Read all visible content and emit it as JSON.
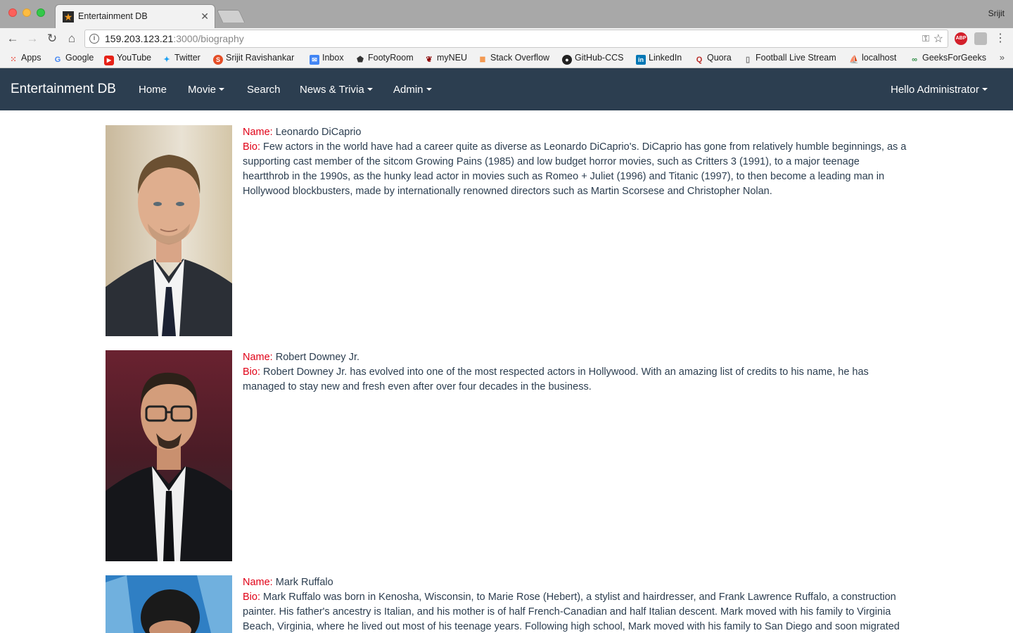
{
  "browser": {
    "tab_title": "Entertainment DB",
    "profile_name": "Srijit",
    "url_host": "159.203.123.21",
    "url_path": ":3000/biography",
    "extensions": [
      "ABP",
      ""
    ],
    "bookmarks": [
      {
        "label": "Apps",
        "icon": "apps-icon"
      },
      {
        "label": "Google",
        "icon": "google-icon"
      },
      {
        "label": "YouTube",
        "icon": "youtube-icon"
      },
      {
        "label": "Twitter",
        "icon": "twitter-icon"
      },
      {
        "label": "Srijit Ravishankar",
        "icon": "profile-icon"
      },
      {
        "label": "Inbox",
        "icon": "inbox-icon"
      },
      {
        "label": "FootyRoom",
        "icon": "footyroom-icon"
      },
      {
        "label": "myNEU",
        "icon": "paw-icon"
      },
      {
        "label": "Stack Overflow",
        "icon": "stackoverflow-icon"
      },
      {
        "label": "GitHub-CCS",
        "icon": "github-icon"
      },
      {
        "label": "LinkedIn",
        "icon": "linkedin-icon"
      },
      {
        "label": "Quora",
        "icon": "quora-icon"
      },
      {
        "label": "Football Live Stream",
        "icon": "page-icon"
      },
      {
        "label": "localhost",
        "icon": "pma-icon"
      },
      {
        "label": "GeeksForGeeks",
        "icon": "geeksforgeeks-icon"
      }
    ]
  },
  "navbar": {
    "brand": "Entertainment DB",
    "links": [
      {
        "label": "Home",
        "dropdown": false
      },
      {
        "label": "Movie",
        "dropdown": true
      },
      {
        "label": "Search",
        "dropdown": false
      },
      {
        "label": "News & Trivia",
        "dropdown": true
      },
      {
        "label": "Admin",
        "dropdown": true
      }
    ],
    "user_menu": "Hello Administrator"
  },
  "labels": {
    "name": "Name:",
    "bio": "Bio:"
  },
  "actors": [
    {
      "name": "Leonardo DiCaprio",
      "bio": "Few actors in the world have had a career quite as diverse as Leonardo DiCaprio's. DiCaprio has gone from relatively humble beginnings, as a supporting cast member of the sitcom Growing Pains (1985) and low budget horror movies, such as Critters 3 (1991), to a major teenage heartthrob in the 1990s, as the hunky lead actor in movies such as Romeo + Juliet (1996) and Titanic (1997), to then become a leading man in Hollywood blockbusters, made by internationally renowned directors such as Martin Scorsese and Christopher Nolan."
    },
    {
      "name": "Robert Downey Jr.",
      "bio": "Robert Downey Jr. has evolved into one of the most respected actors in Hollywood. With an amazing list of credits to his name, he has managed to stay new and fresh even after over four decades in the business."
    },
    {
      "name": "Mark Ruffalo",
      "bio": "Mark Ruffalo was born in Kenosha, Wisconsin, to Marie Rose (Hebert), a stylist and hairdresser, and Frank Lawrence Ruffalo, a construction painter. His father's ancestry is Italian, and his mother is of half French-Canadian and half Italian descent. Mark moved with his family to Virginia Beach, Virginia, where he lived out most of his teenage years. Following high school, Mark moved with his family to San Diego and soon migrated"
    }
  ]
}
